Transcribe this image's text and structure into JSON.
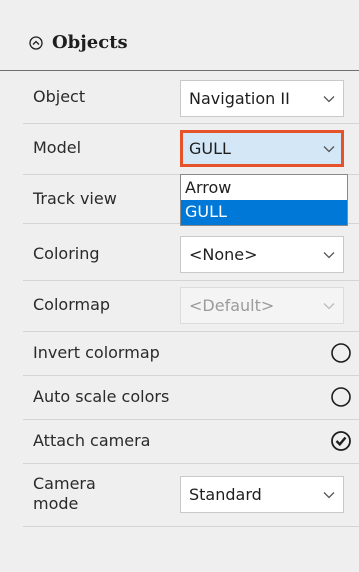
{
  "header": {
    "title": "Objects",
    "toggle_icon": "chevron-up-circle-icon"
  },
  "rows": {
    "object": {
      "label": "Object",
      "value": "Navigation II"
    },
    "model": {
      "label": "Model",
      "value": "GULL"
    },
    "track_view": {
      "label": "Track view"
    },
    "coloring": {
      "label": "Coloring",
      "value": "<None>"
    },
    "colormap": {
      "label": "Colormap",
      "value": "<Default>"
    },
    "invert_colormap": {
      "label": "Invert colormap",
      "checked": false
    },
    "auto_scale_colors": {
      "label": "Auto scale colors",
      "checked": false
    },
    "attach_camera": {
      "label": "Attach camera",
      "checked": true
    },
    "camera_mode": {
      "label_line1": "Camera",
      "label_line2": "mode",
      "value": "Standard"
    }
  },
  "model_dropdown": {
    "options": [
      "Arrow",
      "GULL"
    ],
    "selected": "GULL"
  },
  "colors": {
    "highlight_border": "#e5532b",
    "selection_blue": "#0078d7",
    "panel_bg": "#efefef"
  }
}
